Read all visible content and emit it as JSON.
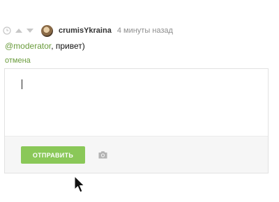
{
  "comment": {
    "author": "crumisYkraina",
    "time": "4 минуты назад",
    "mention": "@moderator",
    "text": ", привет)"
  },
  "reply": {
    "cancel_label": "отмена",
    "input_value": "",
    "send_label": "ОТПРАВИТЬ"
  },
  "icons": {
    "clock": "clock-icon",
    "upvote": "arrow-up-icon",
    "downvote": "arrow-down-icon",
    "camera": "camera-icon",
    "cursor": "mouse-cursor-icon"
  },
  "colors": {
    "accent_green": "#6a9c3c",
    "button_green": "#8ac858",
    "muted": "#8d8d8d"
  }
}
